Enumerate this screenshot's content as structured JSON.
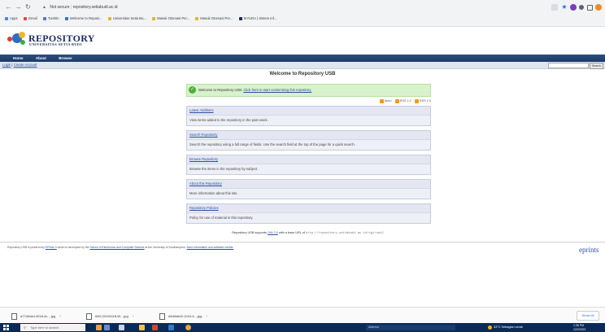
{
  "browser": {
    "security_label": "Not secure",
    "url": "repository.setiabudi.ac.id",
    "bookmarks": [
      {
        "label": "Gmail",
        "color": "#ea4335"
      },
      {
        "label": "Turnitin",
        "color": "#4a7cc0"
      },
      {
        "label": "Welcome to Reposi...",
        "color": "#2f6fd6"
      },
      {
        "label": "Universitas Setia Bu...",
        "color": "#e4b429"
      },
      {
        "label": "Masuk Otomasi Per...",
        "color": "#e4b429"
      },
      {
        "label": "Masuk Otomasi Per...",
        "color": "#e4b429"
      },
      {
        "label": "SIYUDA | Sistem Inf...",
        "color": "#1b2a5e"
      }
    ]
  },
  "site": {
    "logo_title": "REPOSITORY",
    "logo_subtitle": "UNIVERSITAS SETIA BUDI",
    "menu": [
      "Home",
      "About",
      "Browse"
    ],
    "login": "Login",
    "separator": "|",
    "create_account": "Create Account",
    "search_button": "Search"
  },
  "main": {
    "title": "Welcome to Repository USB",
    "welcome_text": "Welcome to Repository USB.",
    "welcome_link": "Click here to start customising this repository.",
    "feeds": {
      "atom": "Atom",
      "rss1": "RSS 1.0",
      "rss2": "RSS 2.0"
    },
    "boxes": [
      {
        "title": "Latest Additions",
        "desc": "View items added to the repository in the past week."
      },
      {
        "title": "Search Repository",
        "desc": "Search the repository using a full range of fields. Use the search field at the top of the page for a quick search."
      },
      {
        "title": "Browse Repository",
        "desc": "Browse the items in the repository by subject."
      },
      {
        "title": "About this Repository",
        "desc": "More information about this site."
      },
      {
        "title": "Repository Policies",
        "desc": "Policy for use of material in this repository."
      }
    ],
    "oai_prefix": "Repository USB supports",
    "oai_link": "OAI 2.0",
    "oai_middle": "with a base URL of",
    "oai_url": "http://repository.setiabudi.ac.id/cgi/oai2"
  },
  "footer": {
    "text_1": "Repository USB is powered by",
    "eprints_link": "EPrints 3",
    "text_2": "which is developed by the",
    "school_link": "School of Electronics and Computer Science",
    "text_3": "at the University of Southampton.",
    "more_link": "More information and software credits.",
    "brand": "eprints"
  },
  "downloads": {
    "items": [
      "a77d0c6d-4018-4c....jpg",
      "IMG-20191118-W....jpg",
      "d9d0e6d2-121b-4....jpg"
    ],
    "show_all": "Show all"
  },
  "taskbar": {
    "search_placeholder": "Type here to search",
    "address_label": "Address",
    "weather": "33°C  Sebagian cerah",
    "time": "1:38 PM",
    "date": "12/2/2021"
  }
}
